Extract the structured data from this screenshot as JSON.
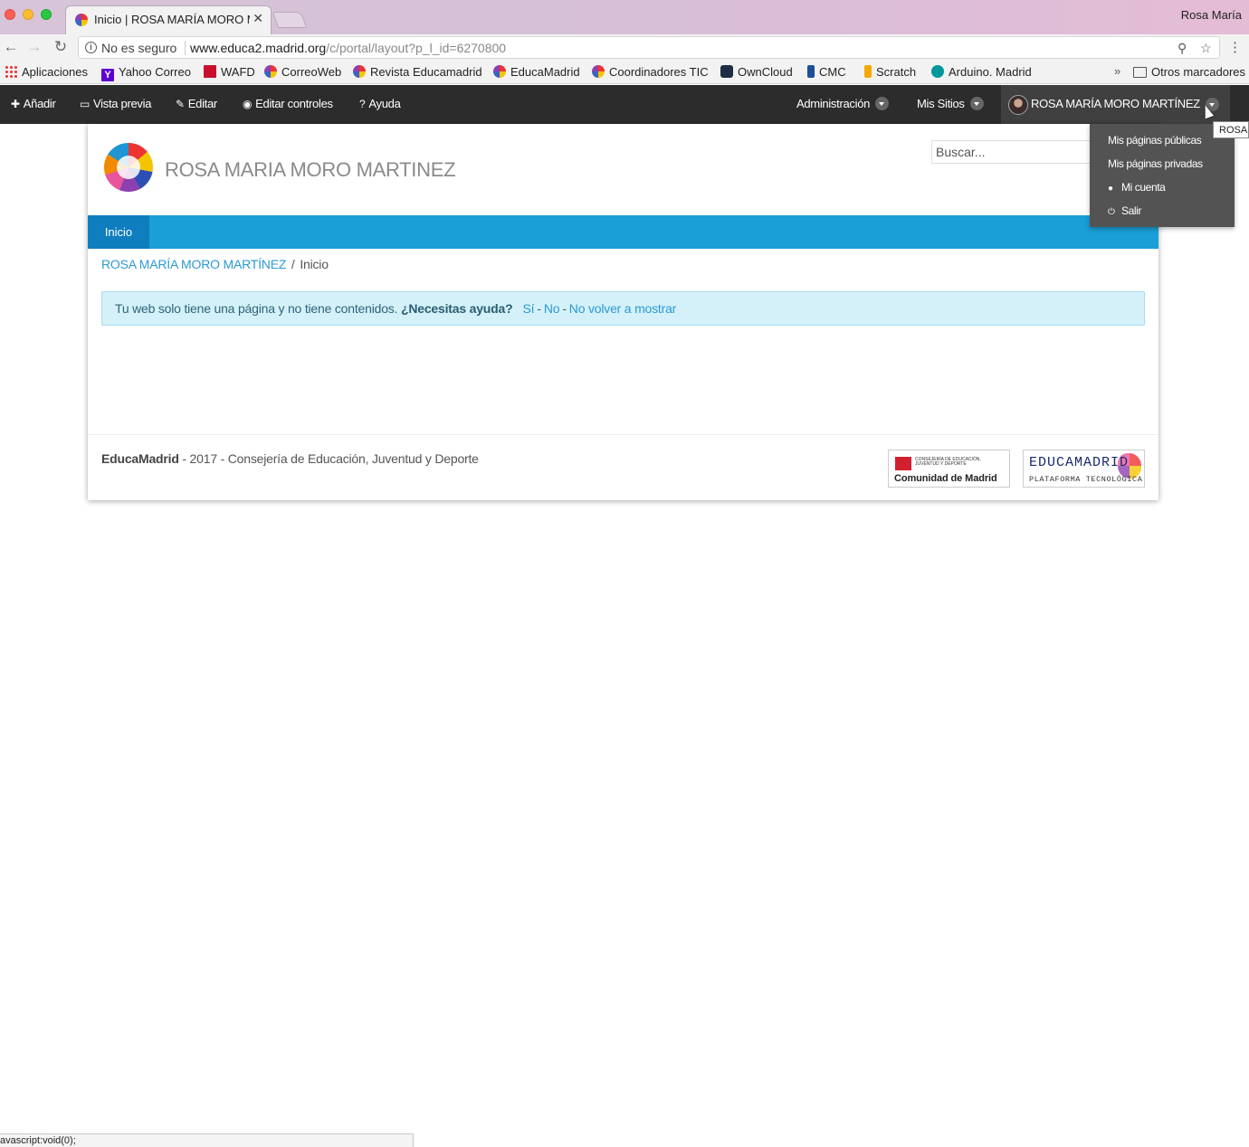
{
  "browser": {
    "tab_title": "Inicio | ROSA MARÍA MORO M",
    "profile_name": "Rosa María",
    "security_label": "No es seguro",
    "url_host": "www.educa2.madrid.org",
    "url_path": "/c/portal/layout?p_l_id=6270800",
    "bookmarks": [
      "Aplicaciones",
      "Yahoo Correo",
      "WAFD",
      "CorreoWeb",
      "Revista Educamadrid",
      "EducaMadrid",
      "Coordinadores TIC",
      "OwnCloud",
      "CMC",
      "Scratch",
      "Arduino. Madrid"
    ],
    "bookmarks_more": "»",
    "other_bookmarks": "Otros marcadores",
    "status_text": "avascript:void(0);"
  },
  "dockbar": {
    "add": "Añadir",
    "preview": "Vista previa",
    "edit": "Editar",
    "edit_controls": "Editar controles",
    "help": "Ayuda",
    "admin": "Administración",
    "my_sites": "Mis Sitios",
    "user": "ROSA MARÍA MORO MARTÍNEZ",
    "tooltip": "ROSA"
  },
  "user_menu": {
    "public_pages": "Mis páginas públicas",
    "private_pages": "Mis páginas privadas",
    "account": "Mi cuenta",
    "logout": "Salir"
  },
  "site": {
    "title": "ROSA MARIA MORO MARTINEZ",
    "search_placeholder": "Buscar...",
    "nav_home": "Inicio",
    "breadcrumb_root": "ROSA MARÍA MORO MARTÍNEZ",
    "breadcrumb_sep": "/",
    "breadcrumb_current": "Inicio"
  },
  "alert": {
    "message": "Tu web solo tiene una página y no tiene contenidos.",
    "question": "¿Necesitas ayuda?",
    "yes": "Sí",
    "no": "No",
    "never": "No volver a mostrar",
    "sep": "-"
  },
  "footer": {
    "brand": "EducaMadrid",
    "text": " - 2017 - Consejería de Educación, Juventud y Deporte",
    "cam_small": "CONSEJERÍA DE EDUCACIÓN, JUVENTUD Y DEPORTE",
    "cam_name": "Comunidad de Madrid",
    "educa_name": "EDUCAMADRID",
    "educa_sub": "PLATAFORMA TECNOLÓGICA"
  }
}
